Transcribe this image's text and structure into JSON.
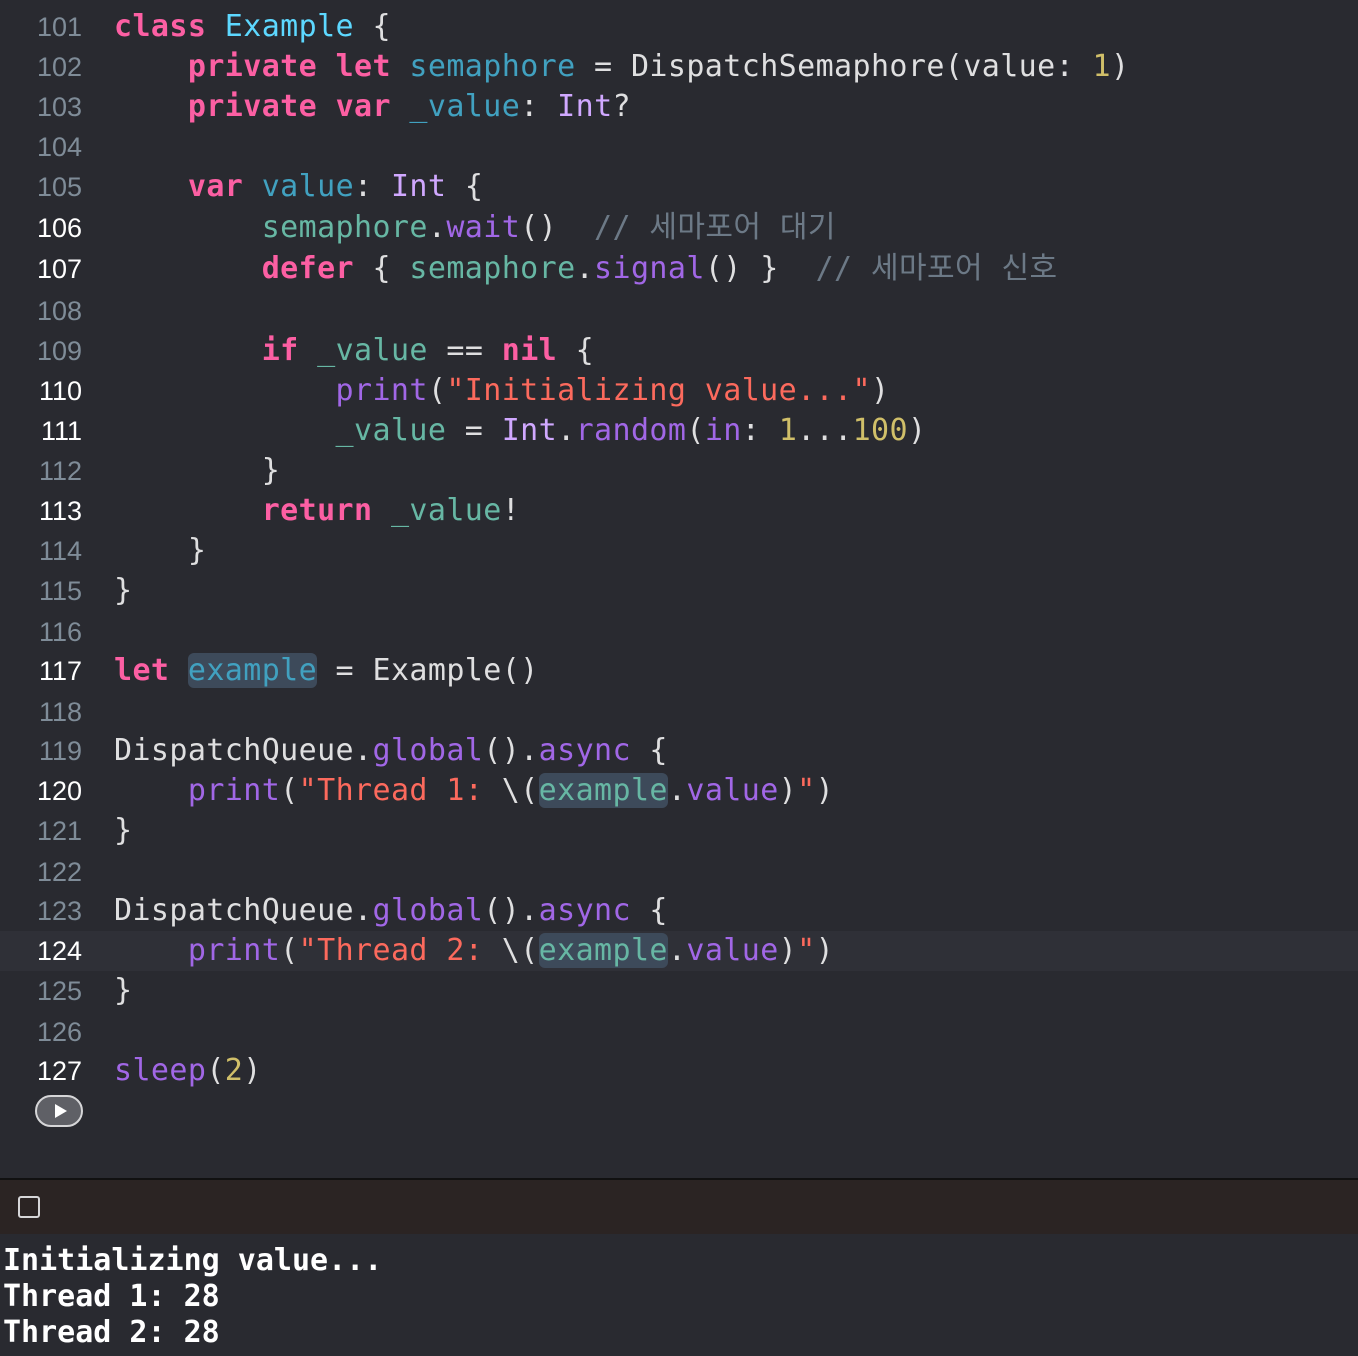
{
  "editor": {
    "lines": [
      {
        "n": "101",
        "code": [
          {
            "t": "class",
            "c": "kw"
          },
          {
            "t": " "
          },
          {
            "t": "Example",
            "c": "tyd"
          },
          {
            "t": " {"
          }
        ]
      },
      {
        "n": "102",
        "code": [
          {
            "t": "    "
          },
          {
            "t": "private",
            "c": "kw"
          },
          {
            "t": " "
          },
          {
            "t": "let",
            "c": "kw"
          },
          {
            "t": " "
          },
          {
            "t": "semaphore",
            "c": "prp"
          },
          {
            "t": " = DispatchSemaphore(value: "
          },
          {
            "t": "1",
            "c": "num"
          },
          {
            "t": ")"
          }
        ]
      },
      {
        "n": "103",
        "code": [
          {
            "t": "    "
          },
          {
            "t": "private",
            "c": "kw"
          },
          {
            "t": " "
          },
          {
            "t": "var",
            "c": "kw"
          },
          {
            "t": " "
          },
          {
            "t": "_value",
            "c": "prp"
          },
          {
            "t": ": "
          },
          {
            "t": "Int",
            "c": "typ"
          },
          {
            "t": "?"
          }
        ]
      },
      {
        "n": "104",
        "code": []
      },
      {
        "n": "105",
        "code": [
          {
            "t": "    "
          },
          {
            "t": "var",
            "c": "kw"
          },
          {
            "t": " "
          },
          {
            "t": "value",
            "c": "prp"
          },
          {
            "t": ": "
          },
          {
            "t": "Int",
            "c": "typ"
          },
          {
            "t": " {"
          }
        ]
      },
      {
        "n": "106",
        "active": true,
        "code": [
          {
            "t": "        "
          },
          {
            "t": "semaphore",
            "c": "loc"
          },
          {
            "t": "."
          },
          {
            "t": "wait",
            "c": "fn"
          },
          {
            "t": "()  "
          },
          {
            "t": "// 세마포어 대기",
            "c": "cmt"
          }
        ]
      },
      {
        "n": "107",
        "active": true,
        "code": [
          {
            "t": "        "
          },
          {
            "t": "defer",
            "c": "kw"
          },
          {
            "t": " { "
          },
          {
            "t": "semaphore",
            "c": "loc"
          },
          {
            "t": "."
          },
          {
            "t": "signal",
            "c": "fn"
          },
          {
            "t": "() }  "
          },
          {
            "t": "// 세마포어 신호",
            "c": "cmt"
          }
        ]
      },
      {
        "n": "108",
        "code": []
      },
      {
        "n": "109",
        "code": [
          {
            "t": "        "
          },
          {
            "t": "if",
            "c": "kw"
          },
          {
            "t": " "
          },
          {
            "t": "_value",
            "c": "loc"
          },
          {
            "t": " == "
          },
          {
            "t": "nil",
            "c": "kw"
          },
          {
            "t": " {"
          }
        ]
      },
      {
        "n": "110",
        "active": true,
        "code": [
          {
            "t": "            "
          },
          {
            "t": "print",
            "c": "fn"
          },
          {
            "t": "("
          },
          {
            "t": "\"Initializing value...\"",
            "c": "str"
          },
          {
            "t": ")"
          }
        ]
      },
      {
        "n": "111",
        "active": true,
        "code": [
          {
            "t": "            "
          },
          {
            "t": "_value",
            "c": "loc"
          },
          {
            "t": " = "
          },
          {
            "t": "Int",
            "c": "typ"
          },
          {
            "t": "."
          },
          {
            "t": "random",
            "c": "fn"
          },
          {
            "t": "("
          },
          {
            "t": "in",
            "c": "fn"
          },
          {
            "t": ": "
          },
          {
            "t": "1",
            "c": "num"
          },
          {
            "t": "..."
          },
          {
            "t": "100",
            "c": "num"
          },
          {
            "t": ")"
          }
        ]
      },
      {
        "n": "112",
        "code": [
          {
            "t": "        }"
          }
        ]
      },
      {
        "n": "113",
        "active": true,
        "code": [
          {
            "t": "        "
          },
          {
            "t": "return",
            "c": "kw"
          },
          {
            "t": " "
          },
          {
            "t": "_value",
            "c": "loc"
          },
          {
            "t": "!"
          }
        ]
      },
      {
        "n": "114",
        "code": [
          {
            "t": "    }"
          }
        ]
      },
      {
        "n": "115",
        "code": [
          {
            "t": "}"
          }
        ]
      },
      {
        "n": "116",
        "code": []
      },
      {
        "n": "117",
        "active": true,
        "code": [
          {
            "t": "let",
            "c": "kw"
          },
          {
            "t": " "
          },
          {
            "t": "example",
            "c": "prp hl"
          },
          {
            "t": " = Example()"
          }
        ]
      },
      {
        "n": "118",
        "code": []
      },
      {
        "n": "119",
        "code": [
          {
            "t": "DispatchQueue."
          },
          {
            "t": "global",
            "c": "fn"
          },
          {
            "t": "()."
          },
          {
            "t": "async",
            "c": "fn"
          },
          {
            "t": " {"
          }
        ]
      },
      {
        "n": "120",
        "active": true,
        "code": [
          {
            "t": "    "
          },
          {
            "t": "print",
            "c": "fn"
          },
          {
            "t": "("
          },
          {
            "t": "\"Thread 1: ",
            "c": "str"
          },
          {
            "t": "\\("
          },
          {
            "t": "example",
            "c": "loc hl"
          },
          {
            "t": "."
          },
          {
            "t": "value",
            "c": "fn"
          },
          {
            "t": ")"
          },
          {
            "t": "\"",
            "c": "str"
          },
          {
            "t": ")"
          }
        ]
      },
      {
        "n": "121",
        "code": [
          {
            "t": "}"
          }
        ]
      },
      {
        "n": "122",
        "code": []
      },
      {
        "n": "123",
        "code": [
          {
            "t": "DispatchQueue."
          },
          {
            "t": "global",
            "c": "fn"
          },
          {
            "t": "()."
          },
          {
            "t": "async",
            "c": "fn"
          },
          {
            "t": " {"
          }
        ]
      },
      {
        "n": "124",
        "active": true,
        "current": true,
        "code": [
          {
            "t": "    "
          },
          {
            "t": "print",
            "c": "fn"
          },
          {
            "t": "("
          },
          {
            "t": "\"Thread 2: ",
            "c": "str"
          },
          {
            "t": "\\("
          },
          {
            "t": "example",
            "c": "loc hl"
          },
          {
            "t": "."
          },
          {
            "t": "value",
            "c": "fn"
          },
          {
            "t": ")"
          },
          {
            "t": "\"",
            "c": "str"
          },
          {
            "t": ")"
          }
        ]
      },
      {
        "n": "125",
        "code": [
          {
            "t": "}"
          }
        ]
      },
      {
        "n": "126",
        "code": []
      },
      {
        "n": "127",
        "active": true,
        "code": [
          {
            "t": "sleep",
            "c": "fn"
          },
          {
            "t": "("
          },
          {
            "t": "2",
            "c": "num"
          },
          {
            "t": ")"
          }
        ]
      }
    ]
  },
  "console": {
    "output": [
      "Initializing value...",
      "Thread 1: 28",
      "Thread 2: 28"
    ]
  },
  "colors": {
    "background": "#292a30",
    "keyword": "#fc5fa3",
    "string": "#fc6a5d",
    "number": "#d0bf69",
    "comment": "#6c7986"
  },
  "icons": {
    "run": "play-icon",
    "console_toggle": "square-icon"
  }
}
